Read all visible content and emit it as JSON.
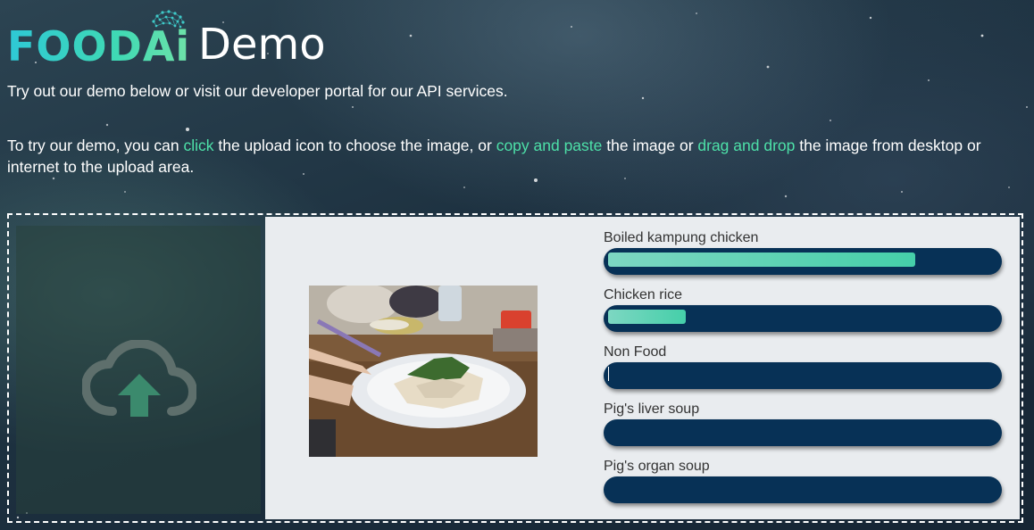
{
  "header": {
    "logo_text": "FOODAi",
    "title": "Demo"
  },
  "intro_text": "Try out our demo below or visit our developer portal for our API services.",
  "instructions": {
    "part1": "To try our demo, you can ",
    "link1": "click",
    "part2": " the upload icon to choose the image, or ",
    "link2": "copy and paste",
    "part3": " the image or ",
    "link3": "drag and drop",
    "part4": " the image from desktop or internet to the upload area."
  },
  "colors": {
    "accent": "#4de0a8",
    "bar_track": "#073156",
    "bar_fill": "#45cfa9"
  },
  "upload": {
    "icon": "cloud-upload-icon"
  },
  "results": [
    {
      "label": "Boiled kampung chicken",
      "score": 0.79
    },
    {
      "label": "Chicken rice",
      "score": 0.2
    },
    {
      "label": "Non Food",
      "score": 0.0
    },
    {
      "label": "Pig's liver soup",
      "score": 0.0
    },
    {
      "label": "Pig's organ soup",
      "score": 0.0
    }
  ]
}
